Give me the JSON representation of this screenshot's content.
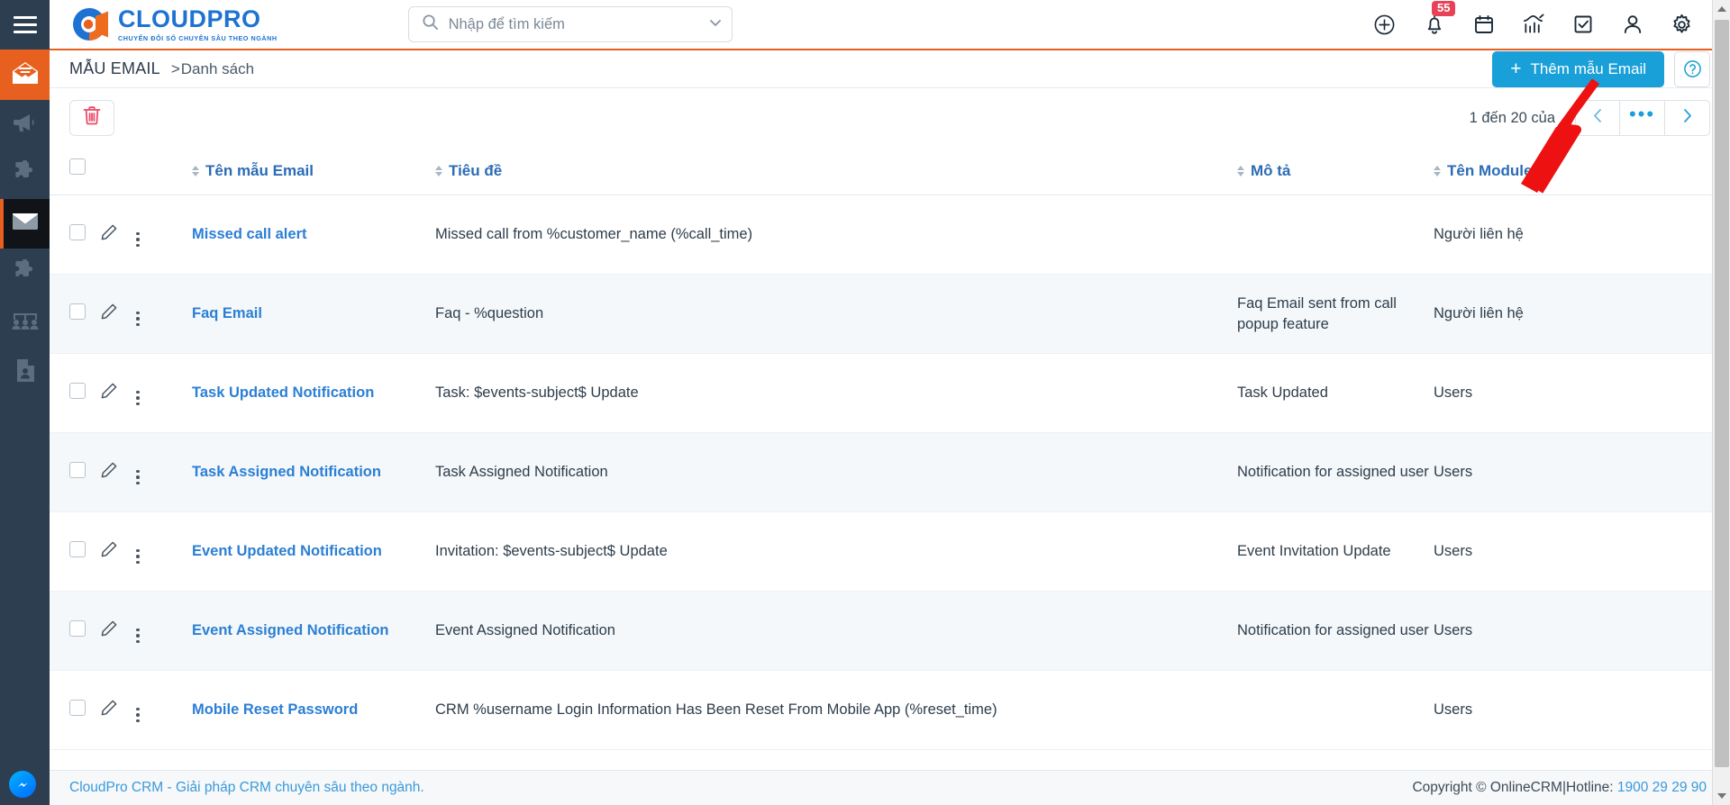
{
  "brand": {
    "name": "CLOUDPRO",
    "tagline": "CHUYỂN ĐỔI SỐ CHUYÊN SÂU THEO NGÀNH",
    "blue": "#1e73d2",
    "orange": "#e8601f"
  },
  "topbar": {
    "menu_icon": "hamburger-icon",
    "search": {
      "value": "",
      "placeholder": "Nhập để tìm kiếm",
      "icon": "search-icon",
      "dropdown_icon": "chevron-down-icon"
    },
    "icons": [
      {
        "name": "add-circle-icon",
        "label": ""
      },
      {
        "name": "notification-bell-icon",
        "label": "",
        "badge": "55"
      },
      {
        "name": "calendar-icon",
        "label": ""
      },
      {
        "name": "analytics-chart-icon",
        "label": ""
      },
      {
        "name": "task-checkbox-icon",
        "label": ""
      },
      {
        "name": "user-profile-icon",
        "label": ""
      },
      {
        "name": "settings-gear-icon",
        "label": ""
      }
    ]
  },
  "sidebar": {
    "items": [
      {
        "name": "sidebar-item-email-campaign",
        "icon": "open-envelope-icon",
        "state": "orange"
      },
      {
        "name": "sidebar-item-marketing",
        "icon": "megaphone-icon",
        "state": "normal"
      },
      {
        "name": "sidebar-item-extension",
        "icon": "puzzle-icon",
        "state": "normal"
      },
      {
        "name": "sidebar-item-email-template",
        "icon": "envelope-icon",
        "state": "active"
      },
      {
        "name": "sidebar-item-addon",
        "icon": "puzzle-icon",
        "state": "normal"
      },
      {
        "name": "sidebar-item-groups",
        "icon": "people-group-icon",
        "state": "normal"
      },
      {
        "name": "sidebar-item-contact-card",
        "icon": "contact-document-icon",
        "state": "normal"
      }
    ]
  },
  "page": {
    "title": "MẪU EMAIL",
    "breadcrumb_separator": ">",
    "breadcrumb": "Danh sách",
    "add_button": {
      "label": "Thêm mẫu Email",
      "plus": "+",
      "color": "#1aa0d8"
    },
    "help_button_icon": "help-circle-icon"
  },
  "toolbar": {
    "delete_icon": "trash-icon",
    "pagination": {
      "range_text": "1 đến 20 của",
      "prev_icon": "chevron-left-icon",
      "more_label": "•••",
      "next_icon": "chevron-right-icon"
    }
  },
  "table": {
    "select_all_checkbox": false,
    "columns": [
      {
        "key": "name",
        "label": "Tên mẫu Email",
        "sortable": true
      },
      {
        "key": "subject",
        "label": "Tiêu đề",
        "sortable": true
      },
      {
        "key": "description",
        "label": "Mô tả",
        "sortable": true
      },
      {
        "key": "module",
        "label": "Tên Module",
        "sortable": true
      }
    ],
    "rows": [
      {
        "name": "Missed call alert",
        "subject": "Missed call from %customer_name (%call_time)",
        "description": "",
        "module": "Người liên hệ"
      },
      {
        "name": "Faq Email",
        "subject": "Faq - %question",
        "description": "Faq Email sent from call popup feature",
        "module": "Người liên hệ"
      },
      {
        "name": "Task Updated Notification",
        "subject": "Task: $events-subject$ Update",
        "description": "Task Updated",
        "module": "Users"
      },
      {
        "name": "Task Assigned Notification",
        "subject": "Task Assigned Notification",
        "description": "Notification for assigned user",
        "module": "Users"
      },
      {
        "name": "Event Updated Notification",
        "subject": "Invitation: $events-subject$ Update",
        "description": "Event Invitation Update",
        "module": "Users"
      },
      {
        "name": "Event Assigned Notification",
        "subject": "Event Assigned Notification",
        "description": "Notification for assigned user",
        "module": "Users"
      },
      {
        "name": "Mobile Reset Password",
        "subject": "CRM %username Login Information Has Been Reset From Mobile App (%reset_time)",
        "description": "",
        "module": "Users"
      }
    ],
    "row_edit_icon": "pencil-icon",
    "row_more_icon": "more-vertical-icon"
  },
  "footer": {
    "left": "CloudPro CRM - Giải pháp CRM chuyên sâu theo ngành.",
    "copyright": "Copyright © OnlineCRM",
    "separator": "|",
    "hotline_label": "Hotline:",
    "hotline_number": "1900 29 29 90"
  },
  "messenger": {
    "icon": "messenger-chat-icon"
  },
  "annotation": {
    "type": "red-arrow",
    "color": "#ee1111"
  }
}
